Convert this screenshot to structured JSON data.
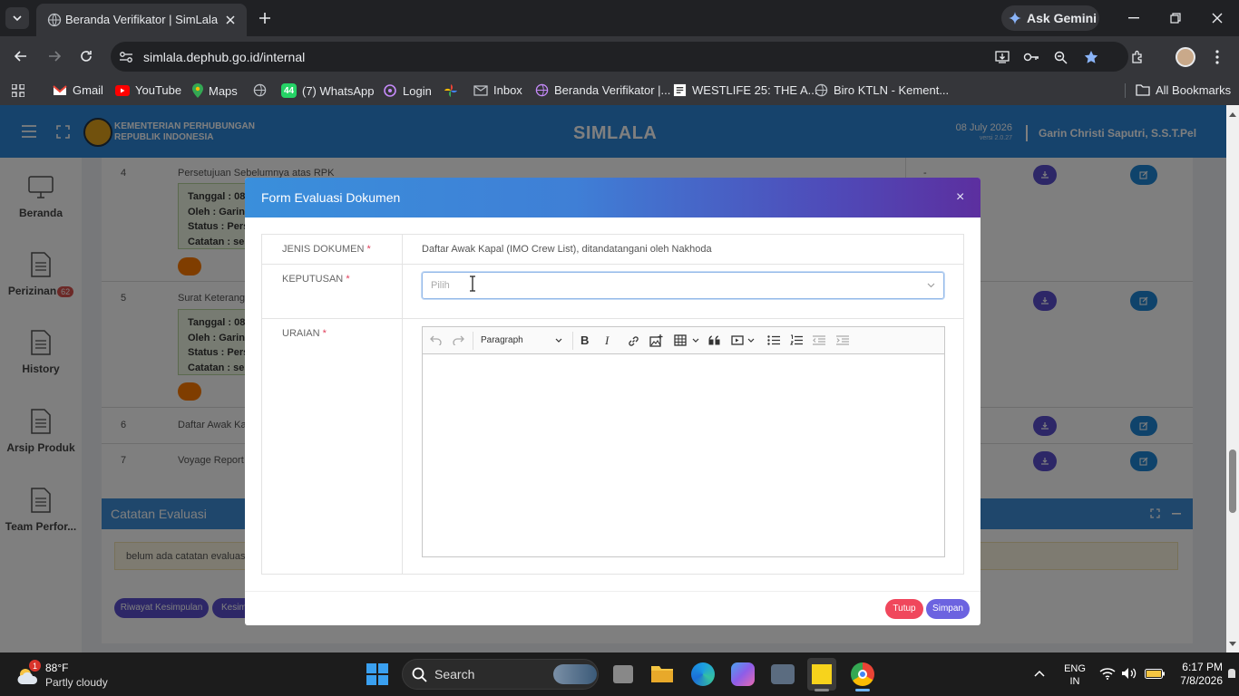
{
  "browser": {
    "tab_title": "Beranda Verifikator | SimLala",
    "url": "simlala.dephub.go.id/internal",
    "ask_gemini": "Ask Gemini",
    "bookmarks": [
      "Gmail",
      "YouTube",
      "Maps",
      "(7) WhatsApp",
      "Login",
      "Inbox",
      "Beranda Verifikator |...",
      "WESTLIFE 25: THE A...",
      "Biro KTLN - Kement..."
    ],
    "whatsapp_badge": "44",
    "all_bookmarks": "All Bookmarks"
  },
  "app": {
    "org_line1": "KEMENTERIAN PERHUBUNGAN",
    "org_line2": "REPUBLIK INDONESIA",
    "title": "SIMLALA",
    "date": "08 July 2026",
    "version": "versi 2.0.27",
    "user": "Garin Christi Saputri, S.S.T.Pel"
  },
  "sidebar": {
    "items": [
      {
        "label": "Beranda",
        "icon": "desktop-icon"
      },
      {
        "label": "Perizinan",
        "badge": "62",
        "icon": "document-icon"
      },
      {
        "label": "History",
        "icon": "document-icon"
      },
      {
        "label": "Arsip Produk",
        "icon": "document-icon"
      },
      {
        "label": "Team Perfor...",
        "icon": "document-icon"
      }
    ]
  },
  "table": {
    "rows": [
      {
        "no": "4",
        "title": "Persetujuan Sebelumnya atas RPK",
        "status_col": "-",
        "info": {
          "tanggal": "Tanggal : 08",
          "oleh": "Oleh : Garin",
          "status": "Status : Perse",
          "catatan": "Catatan : ses"
        }
      },
      {
        "no": "5",
        "title": "Surat Keterangan",
        "info": {
          "tanggal": "Tanggal : 08",
          "oleh": "Oleh : Garin",
          "status": "Status : Perse",
          "catatan": "Catatan : ses"
        }
      },
      {
        "no": "6",
        "title": "Daftar Awak Kap"
      },
      {
        "no": "7",
        "title": "Voyage Report ("
      }
    ]
  },
  "evaluasi": {
    "title": "Catatan Evaluasi",
    "empty_note": "belum ada catatan evaluasi",
    "btn_riwayat": "Riwayat Kesimpulan",
    "btn_kesim": "Kesim"
  },
  "modal": {
    "title": "Form Evaluasi Dokumen",
    "close": "×",
    "jenis_label": "JENIS DOKUMEN",
    "jenis_value": "Daftar Awak Kapal (IMO Crew List), ditandatangani oleh Nakhoda",
    "keputusan_label": "KEPUTUSAN",
    "keputusan_placeholder": "Pilih",
    "uraian_label": "URAIAN",
    "required_mark": "*",
    "editor_paragraph": "Paragraph",
    "btn_tutup": "Tutup",
    "btn_simpan": "Simpan"
  },
  "taskbar": {
    "temp": "88°F",
    "weather": "Partly cloudy",
    "weather_badge": "1",
    "search": "Search",
    "lang1": "ENG",
    "lang2": "IN",
    "time": "6:17 PM",
    "date": "7/8/2026"
  }
}
